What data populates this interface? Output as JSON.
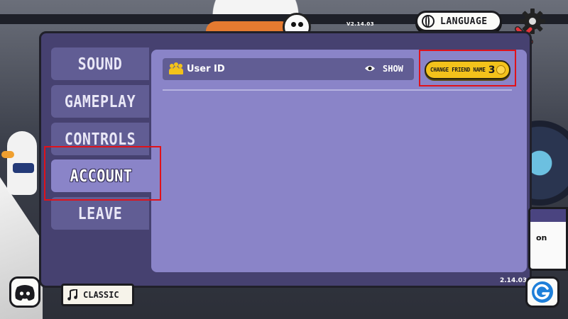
{
  "header": {
    "version_top": "V2.14.03",
    "language_label": "LANGUAGE"
  },
  "sidebar": {
    "tabs": [
      {
        "label": "SOUND",
        "active": false
      },
      {
        "label": "GAMEPLAY",
        "active": false
      },
      {
        "label": "CONTROLS",
        "active": false
      },
      {
        "label": "ACCOUNT",
        "active": true
      },
      {
        "label": "LEAVE",
        "active": false
      }
    ]
  },
  "account": {
    "user_id_label": "User ID",
    "show_label": "SHOW",
    "change_friend_name_label": "CHANGE FRIEND NAME",
    "change_friend_name_cost": "3"
  },
  "footer": {
    "music_label": "CLASSIC",
    "version": "2.14.03",
    "side_card_text": "on"
  },
  "colors": {
    "panel_bg": "#464170",
    "content_bg": "#8a84c8",
    "tab_bg": "#615d94",
    "accent_yellow": "#f3c21b",
    "highlight_red": "#e0121a"
  },
  "icons": {
    "language": "globe-icon",
    "settings": "gear-icon",
    "close": "close-icon",
    "user": "users-icon",
    "show": "eye-icon",
    "currency": "coin-icon",
    "music": "music-note-icon",
    "discord": "discord-icon",
    "gamer_journal": "gamerjournal-icon"
  }
}
